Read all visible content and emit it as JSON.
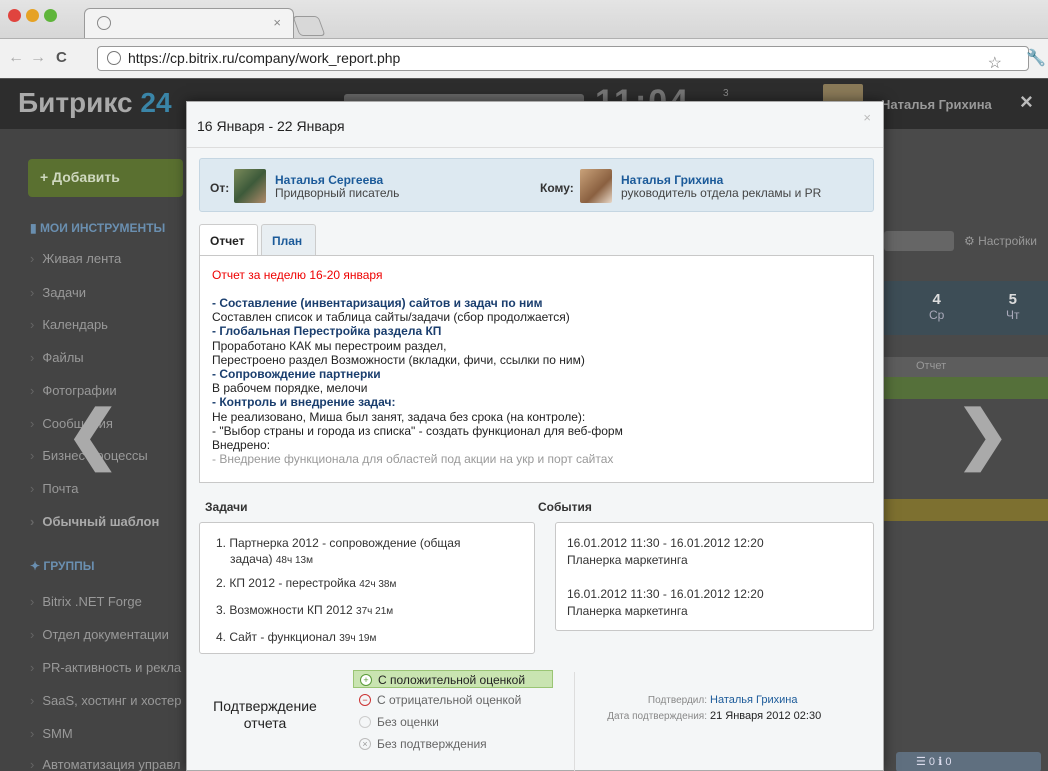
{
  "browser": {
    "tab_close": "×",
    "url": "https://cp.bitrix.ru/company/work_report.php",
    "back": "←",
    "forward": "→",
    "reload": "C",
    "star": "☆"
  },
  "header": {
    "logo_main": "Битрикс",
    "logo_num": "24",
    "clock": "11:04",
    "count": "3",
    "user_name": "Наталья Грихина",
    "close": "×"
  },
  "sidebar": {
    "add_label": "+ Добавить",
    "tools_title": "МОИ ИНСТРУМЕНТЫ",
    "tools": [
      "Живая лента",
      "Задачи",
      "Календарь",
      "Файлы",
      "Фотографии",
      "Сообщения",
      "Бизнес-процессы",
      "Почта"
    ],
    "template": "Обычный шаблон",
    "groups_title": "ГРУППЫ",
    "groups": [
      "Bitrix .NET Forge",
      "Отдел документации",
      "PR-активность и рекла",
      "SaaS, хостинг и хостер",
      "SMM",
      "Автоматизация управл"
    ]
  },
  "background_right": {
    "settings": "Настройки",
    "days": [
      {
        "num": "4",
        "name": "Ср"
      },
      {
        "num": "5",
        "name": "Чт"
      }
    ],
    "report_col": "Отчет",
    "counters": "☰ 0   ℹ 0"
  },
  "nav": {
    "prev": "❮",
    "next": "❯"
  },
  "modal": {
    "title": "16 Января - 22 Января",
    "close": "×",
    "from_label": "От:",
    "from_name": "Наталья Сергеева",
    "from_role": "Придворный писатель",
    "to_label": "Кому:",
    "to_name": "Наталья Грихина",
    "to_role": "руководитель отдела рекламы и PR",
    "tabs": [
      "Отчет",
      "План"
    ],
    "report_title": "Отчет за неделю 16-20 января",
    "report_lines": [
      {
        "text": "- Составление (инвентаризация) сайтов и задач по ним",
        "bold": true
      },
      {
        "text": "Составлен список и таблица сайты/задачи (сбор продолжается)",
        "bold": false
      },
      {
        "text": "- Глобальная Перестройка раздела КП",
        "bold": true
      },
      {
        "text": "Проработано КАК мы перестроим раздел,",
        "bold": false
      },
      {
        "text": "Перестроено раздел Возможности (вкладки, фичи, ссылки по ним)",
        "bold": false
      },
      {
        "text": "- Сопровождение партнерки",
        "bold": true
      },
      {
        "text": "В рабочем порядке, мелочи",
        "bold": false
      },
      {
        "text": "- Контроль и внедрение задач:",
        "bold": true
      },
      {
        "text": "Не реализовано, Миша был занят, задача без срока (на контроле):",
        "bold": false
      },
      {
        "text": "- \"Выбор страны и города из списка\" - создать функционал для веб-форм",
        "bold": false
      },
      {
        "text": "Внедрено:",
        "bold": false
      },
      {
        "text": "- Внедрение функционала для областей под акции на укр и порт сайтах",
        "bold": false
      }
    ],
    "tasks_title": "Задачи",
    "tasks": [
      {
        "line1": "1. Партнерка 2012 - сопровождение (общая",
        "line2": "задача)",
        "time": "48ч 13м"
      },
      {
        "line1": "2. КП 2012 - перестройка",
        "line2": "",
        "time": "42ч 38м"
      },
      {
        "line1": "3. Возможности КП 2012",
        "line2": "",
        "time": "37ч 21м"
      },
      {
        "line1": "4. Сайт - функционал",
        "line2": "",
        "time": "39ч 19м"
      }
    ],
    "events_title": "События",
    "events": [
      {
        "time": "16.01.2012 11:30 - 16.01.2012 12:20",
        "name": "Планерка маркетинга"
      },
      {
        "time": "16.01.2012 11:30 - 16.01.2012 12:20",
        "name": "Планерка маркетинга"
      }
    ],
    "confirm_title_1": "Подтверждение",
    "confirm_title_2": "отчета",
    "options": [
      {
        "label": "С положительной оценкой",
        "icon": "+"
      },
      {
        "label": "С отрицательной оценкой",
        "icon": "−"
      },
      {
        "label": "Без оценки",
        "icon": ""
      },
      {
        "label": "Без подтверждения",
        "icon": "×"
      }
    ],
    "confirmed_by_label": "Подтвердил:",
    "confirmed_by": "Наталья Грихина",
    "confirm_date_label": "Дата подтверждения:",
    "confirm_date": "21 Января 2012 02:30"
  },
  "colors": {
    "accent": "#1b5a99",
    "positive": "#c9e4b1",
    "negative": "#cc3333",
    "report_title": "#ee0000"
  }
}
